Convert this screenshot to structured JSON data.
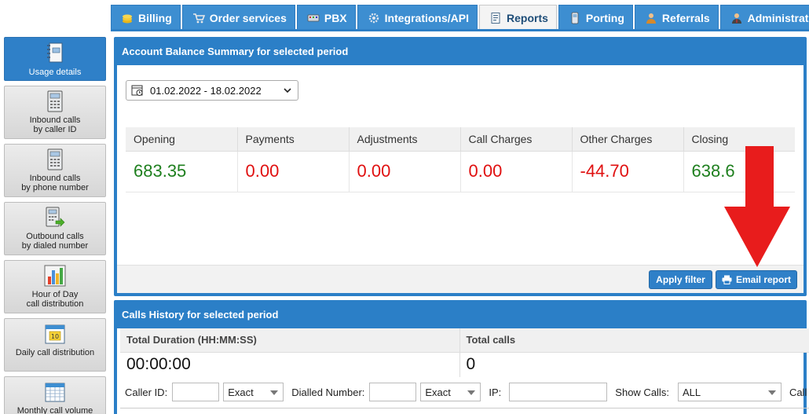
{
  "tabs": [
    {
      "label": "Billing",
      "icon": "coins-icon"
    },
    {
      "label": "Order services",
      "icon": "cart-icon"
    },
    {
      "label": "PBX",
      "icon": "pbx-icon"
    },
    {
      "label": "Integrations/API",
      "icon": "gear-icon"
    },
    {
      "label": "Reports",
      "icon": "report-icon",
      "active": true
    },
    {
      "label": "Porting",
      "icon": "phone-icon"
    },
    {
      "label": "Referrals",
      "icon": "user-icon"
    },
    {
      "label": "Administrators",
      "icon": "admin-icon"
    }
  ],
  "sidebar": {
    "items": [
      {
        "label": "Usage details",
        "icon": "notebook-icon",
        "active": true
      },
      {
        "label": "Inbound calls\nby caller ID",
        "icon": "phone-keypad-icon"
      },
      {
        "label": "Inbound calls\nby phone number",
        "icon": "phone-keypad-icon"
      },
      {
        "label": "Outbound calls\nby dialed number",
        "icon": "phone-outbound-icon"
      },
      {
        "label": "Hour of Day\ncall distribution",
        "icon": "bar-chart-icon"
      },
      {
        "label": "Daily call distribution",
        "icon": "calendar-icon"
      },
      {
        "label": "Monthly call volume",
        "icon": "calendar-grid-icon"
      }
    ]
  },
  "summary": {
    "title": "Account Balance Summary for selected period",
    "date_range": "01.02.2022 - 18.02.2022",
    "columns": [
      "Opening",
      "Payments",
      "Adjustments",
      "Call Charges",
      "Other Charges",
      "Closing"
    ],
    "values": [
      "683.35",
      "0.00",
      "0.00",
      "0.00",
      "-44.70",
      "638.6"
    ],
    "colors": {
      "positive": "#1e7f1e",
      "negative": "#e01010"
    },
    "apply_label": "Apply filter",
    "email_label": "Email report"
  },
  "history": {
    "title": "Calls History for selected period",
    "duration_label": "Total Duration (HH:MM:SS)",
    "duration_value": "00:00:00",
    "calls_label": "Total calls",
    "calls_value": "0",
    "filters": {
      "caller_id_label": "Caller ID:",
      "caller_id_value": "",
      "caller_match": "Exact",
      "dialled_label": "Dialled Number:",
      "dialled_value": "",
      "dialled_match": "Exact",
      "ip_label": "IP:",
      "ip_value": "",
      "show_calls_label": "Show Calls:",
      "show_calls_value": "ALL",
      "call_type_label": "Call Typ"
    }
  },
  "annotation_arrow_color": "#e81c1c"
}
